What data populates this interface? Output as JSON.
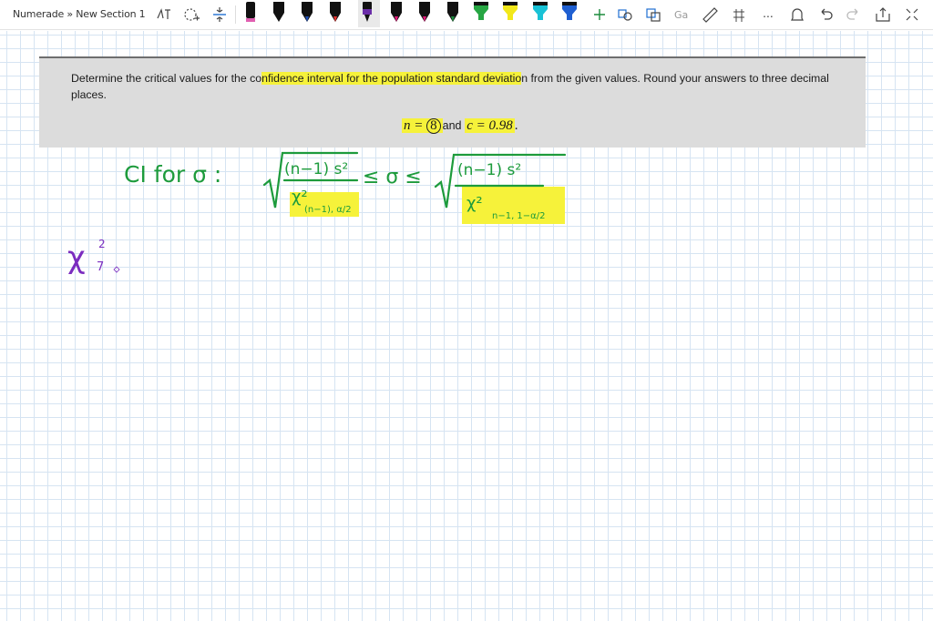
{
  "app": {
    "breadcrumb": "Numerade » New Section 1"
  },
  "toolbar": {
    "tools": [
      "lasso-select-icon",
      "add-space-icon",
      "pen-icon",
      "highlighter-icon",
      "add-pen-icon",
      "shape-icon",
      "ink-to-text-icon",
      "ruler-icon",
      "more-icon",
      "undo-icon",
      "redo-icon",
      "fullscreen-icon"
    ],
    "pen_colors": [
      "#e05fb1",
      "#111111",
      "#1f4fb5",
      "#e6322f",
      "#6a2da8",
      "#e4197a",
      "#e4197a",
      "#1b8a3c",
      "#27a643",
      "#f2e81a",
      "#19c2d6",
      "#1f5fd1"
    ],
    "more_label": "..."
  },
  "problem": {
    "text_before": "Determine the critical values for the co",
    "text_highlight": "nfidence interval for the population standard deviatio",
    "text_after": "n from the given values. Round your answers to three decimal places.",
    "formula_n_label": "n =",
    "formula_n_value": "8",
    "formula_and": "and",
    "formula_c": "c = 0.98",
    "formula_period": "."
  },
  "handwriting": {
    "ci_label": "CI for σ :",
    "numerator_left": "(n−1) s²",
    "denominator_left_chi": "χ²",
    "denominator_left_sub": "(n−1), α/2",
    "relation": "≤ σ ≤",
    "numerator_right": "(n−1) s²",
    "denominator_right_chi": "χ²",
    "denominator_right_sub": "n−1, 1−α/2",
    "chi_partial": "χ",
    "chi_partial_sup": "2",
    "chi_partial_sub": "7",
    "ink_color_green": "#1d9b3c",
    "ink_color_purple": "#7b2cbf",
    "highlight_color": "#f6f23a"
  }
}
